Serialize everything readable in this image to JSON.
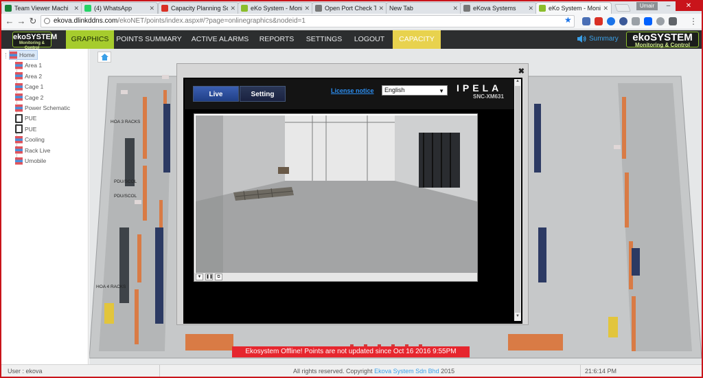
{
  "browser": {
    "tabs": [
      {
        "title": "Team Viewer Machi",
        "icon": "spreadsheet-icon",
        "color": "#188038"
      },
      {
        "title": "(4) WhatsApp",
        "icon": "whatsapp-icon",
        "color": "#25d366"
      },
      {
        "title": "Capacity Planning Sc",
        "icon": "gmail-icon",
        "color": "#d93025"
      },
      {
        "title": "eKo System - Monit",
        "icon": "ekosystem-icon",
        "color": "#8bbd2c"
      },
      {
        "title": "Open Port Check To",
        "icon": "page-icon",
        "color": "#777777"
      },
      {
        "title": "New Tab",
        "icon": "",
        "color": ""
      },
      {
        "title": "eKova Systems",
        "icon": "page-icon",
        "color": "#777777"
      },
      {
        "title": "eKo System - Monito",
        "icon": "ekosystem-icon",
        "color": "#8bbd2c"
      }
    ],
    "profile": "Umair",
    "window_controls": [
      "–",
      "□",
      "✕"
    ],
    "url_host": "ekova.dlinkddns.com",
    "url_path": "/ekoNET/points/index.aspx#/?page=onlinegraphics&nodeid=1"
  },
  "app": {
    "logo_main": "ekoSYSTEM",
    "logo_sub": "Monitoring & Control",
    "nav": [
      {
        "label": "GRAPHICS",
        "style": "green"
      },
      {
        "label": "POINTS SUMMARY",
        "style": ""
      },
      {
        "label": "ACTIVE ALARMS",
        "style": ""
      },
      {
        "label": "REPORTS",
        "style": "dropdown"
      },
      {
        "label": "SETTINGS",
        "style": ""
      },
      {
        "label": "LOGOUT",
        "style": ""
      },
      {
        "label": "CAPACITY",
        "style": "yellow"
      }
    ],
    "summary_label": "Summary",
    "accent_green": "#a6cc2d",
    "accent_yellow": "#e8d24e"
  },
  "tree": [
    {
      "label": "Home",
      "type": "home"
    },
    {
      "label": "Area 1",
      "type": "stack"
    },
    {
      "label": "Area 2",
      "type": "stack"
    },
    {
      "label": "Cage 1",
      "type": "stack"
    },
    {
      "label": "Cage 2",
      "type": "stack"
    },
    {
      "label": "Power Schematic",
      "type": "stack"
    },
    {
      "label": "PUE",
      "type": "pue"
    },
    {
      "label": "PUE",
      "type": "pue"
    },
    {
      "label": "Cooling",
      "type": "stack"
    },
    {
      "label": "Rack Live",
      "type": "stack"
    },
    {
      "label": "Umobile",
      "type": "stack"
    }
  ],
  "floor_labels": [
    "HOA 3 RACKS",
    "PDU/SCOL",
    "PDU/SCOL",
    "HOA 4 RACKS"
  ],
  "camera": {
    "tab_live": "Live",
    "tab_setting": "Setting",
    "license": "License notice",
    "language": "English",
    "brand": "IPELA",
    "model": "SNC-XM631",
    "controls": [
      "▼",
      "❚❚",
      "⧉"
    ]
  },
  "offline_message": "Ekosystem Offline! Points are not updated since Oct 16 2016 9:55PM",
  "status": {
    "user": "User : ekova",
    "copyright_prefix": "All rights reserved. Copyright",
    "copyright_company": "Ekova System Sdn Bhd",
    "copyright_year": "2015",
    "time": "21:6:14 PM"
  }
}
